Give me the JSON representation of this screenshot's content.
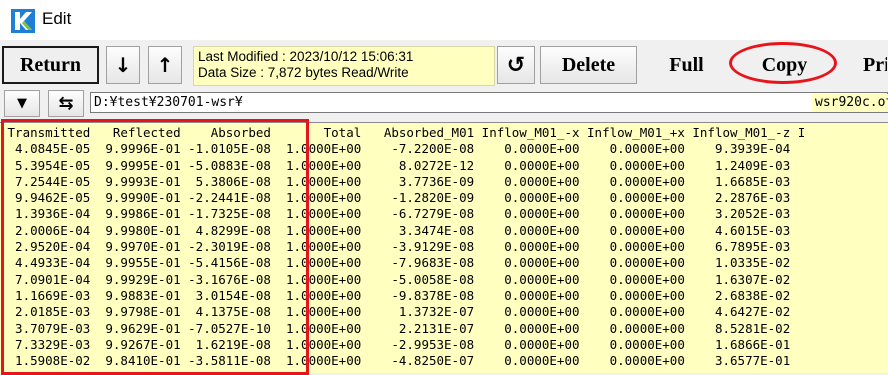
{
  "window": {
    "title": "Edit",
    "app_icon": "k-logo-icon"
  },
  "toolbar": {
    "return_label": "Return",
    "down_arrow": "↓",
    "up_arrow": "↑",
    "last_modified": "Last Modified : 2023/10/12 15:06:31",
    "data_size": "Data Size : 7,872 bytes  Read/Write",
    "reload_icon": "↺",
    "delete_label": "Delete",
    "full_label": "Full",
    "copy_label": "Copy",
    "print_label": "Pri"
  },
  "pathbar": {
    "dropdown_icon": "▼",
    "swap_icon": "⇆",
    "path": "D:¥test¥230701-wsr¥",
    "file": "wsr920c.ot"
  },
  "table": {
    "columns": [
      "Transmitted",
      "Reflected",
      "Absorbed",
      "Total",
      "Absorbed_M01",
      "Inflow_M01_-x",
      "Inflow_M01_+x",
      "Inflow_M01_-z",
      "I"
    ],
    "rows": [
      [
        "4.0845E-05",
        "9.9996E-01",
        "-1.0105E-08",
        "1.0000E+00",
        "-7.2200E-08",
        "0.0000E+00",
        "0.0000E+00",
        "9.3939E-04"
      ],
      [
        "5.3954E-05",
        "9.9995E-01",
        "-5.0883E-08",
        "1.0000E+00",
        "8.0272E-12",
        "0.0000E+00",
        "0.0000E+00",
        "1.2409E-03"
      ],
      [
        "7.2544E-05",
        "9.9993E-01",
        "5.3806E-08",
        "1.0000E+00",
        "3.7736E-09",
        "0.0000E+00",
        "0.0000E+00",
        "1.6685E-03"
      ],
      [
        "9.9462E-05",
        "9.9990E-01",
        "-2.2441E-08",
        "1.0000E+00",
        "-1.2820E-09",
        "0.0000E+00",
        "0.0000E+00",
        "2.2876E-03"
      ],
      [
        "1.3936E-04",
        "9.9986E-01",
        "-1.7325E-08",
        "1.0000E+00",
        "-6.7279E-08",
        "0.0000E+00",
        "0.0000E+00",
        "3.2052E-03"
      ],
      [
        "2.0006E-04",
        "9.9980E-01",
        "4.8299E-08",
        "1.0000E+00",
        "3.3474E-08",
        "0.0000E+00",
        "0.0000E+00",
        "4.6015E-03"
      ],
      [
        "2.9520E-04",
        "9.9970E-01",
        "-2.3019E-08",
        "1.0000E+00",
        "-3.9129E-08",
        "0.0000E+00",
        "0.0000E+00",
        "6.7895E-03"
      ],
      [
        "4.4933E-04",
        "9.9955E-01",
        "-5.4156E-08",
        "1.0000E+00",
        "-7.9683E-08",
        "0.0000E+00",
        "0.0000E+00",
        "1.0335E-02"
      ],
      [
        "7.0901E-04",
        "9.9929E-01",
        "-3.1676E-08",
        "1.0000E+00",
        "-5.0058E-08",
        "0.0000E+00",
        "0.0000E+00",
        "1.6307E-02"
      ],
      [
        "1.1669E-03",
        "9.9883E-01",
        "3.0154E-08",
        "1.0000E+00",
        "-9.8378E-08",
        "0.0000E+00",
        "0.0000E+00",
        "2.6838E-02"
      ],
      [
        "2.0185E-03",
        "9.9798E-01",
        "4.1375E-08",
        "1.0000E+00",
        "1.3732E-07",
        "0.0000E+00",
        "0.0000E+00",
        "4.6427E-02"
      ],
      [
        "3.7079E-03",
        "9.9629E-01",
        "-7.0527E-10",
        "1.0000E+00",
        "2.2131E-07",
        "0.0000E+00",
        "0.0000E+00",
        "8.5281E-02"
      ],
      [
        "7.3329E-03",
        "9.9267E-01",
        "1.6219E-08",
        "1.0000E+00",
        "-2.9953E-08",
        "0.0000E+00",
        "0.0000E+00",
        "1.6866E-01"
      ],
      [
        "1.5908E-02",
        "9.8410E-01",
        "-3.5811E-08",
        "1.0000E+00",
        "-4.8250E-07",
        "0.0000E+00",
        "0.0000E+00",
        "3.6577E-01"
      ]
    ]
  },
  "colors": {
    "grid_bg": "#ffffc0",
    "highlight": "#e8141b"
  }
}
